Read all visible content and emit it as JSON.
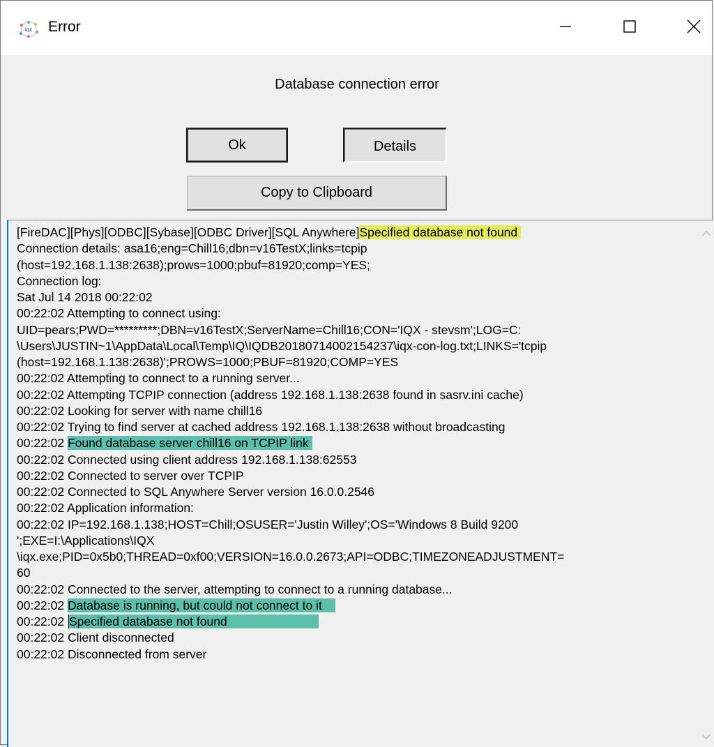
{
  "window": {
    "title": "Error",
    "icon": "iqx-app-icon",
    "controls": [
      "minimize-icon",
      "maximize-icon",
      "close-icon"
    ]
  },
  "message": "Database connection error",
  "buttons": {
    "ok": "Ok",
    "details": "Details",
    "copy": "Copy to Clipboard"
  },
  "log": {
    "lines": [
      {
        "pre": "[FireDAC][Phys][ODBC][Sybase][ODBC Driver][SQL Anywhere]",
        "hl": "Specified database not found ",
        "hl_color": "yellow",
        "post": ""
      },
      {
        "pre": "Connection details: asa16;eng=Chill16;dbn=v16TestX;links=tcpip",
        "hl": "",
        "post": ""
      },
      {
        "pre": "(host=192.168.1.138:2638);prows=1000;pbuf=81920;comp=YES;",
        "hl": "",
        "post": ""
      },
      {
        "pre": "Connection log:",
        "hl": "",
        "post": ""
      },
      {
        "pre": "Sat Jul 14 2018 00:22:02",
        "hl": "",
        "post": ""
      },
      {
        "pre": "00:22:02 Attempting to connect using:",
        "hl": "",
        "post": ""
      },
      {
        "pre": "UID=pears;PWD=*********;DBN=v16TestX;ServerName=Chill16;CON='IQX - stevsm';LOG=C:",
        "hl": "",
        "post": ""
      },
      {
        "pre": "\\Users\\JUSTIN~1\\AppData\\Local\\Temp\\IQ\\IQDB20180714002154237\\iqx-con-log.txt;LINKS='tcpip",
        "hl": "",
        "post": ""
      },
      {
        "pre": "(host=192.168.1.138:2638)';PROWS=1000;PBUF=81920;COMP=YES",
        "hl": "",
        "post": ""
      },
      {
        "pre": "00:22:02 Attempting to connect to a running server...",
        "hl": "",
        "post": ""
      },
      {
        "pre": "00:22:02 Attempting TCPIP connection (address 192.168.1.138:2638 found in sasrv.ini cache)",
        "hl": "",
        "post": ""
      },
      {
        "pre": "00:22:02 Looking for server with name chill16",
        "hl": "",
        "post": ""
      },
      {
        "pre": "00:22:02 Trying to find server at cached address 192.168.1.138:2638 without broadcasting",
        "hl": "",
        "post": ""
      },
      {
        "pre": "00:22:02 ",
        "hl": "Found database server chill16 on TCPIP link ",
        "hl_color": "teal",
        "post": ""
      },
      {
        "pre": "00:22:02 Connected using client address 192.168.1.138:62553",
        "hl": "",
        "post": ""
      },
      {
        "pre": "00:22:02 Connected to server over TCPIP",
        "hl": "",
        "post": ""
      },
      {
        "pre": "00:22:02 Connected to SQL Anywhere Server version 16.0.0.2546",
        "hl": "",
        "post": ""
      },
      {
        "pre": "00:22:02 Application information:",
        "hl": "",
        "post": ""
      },
      {
        "pre": "00:22:02 IP=192.168.1.138;HOST=Chill;OSUSER='Justin Willey';OS='Windows 8 Build 9200",
        "hl": "",
        "post": ""
      },
      {
        "pre": "';EXE=I:\\Applications\\IQX",
        "hl": "",
        "post": ""
      },
      {
        "pre": "\\iqx.exe;PID=0x5b0;THREAD=0xf00;VERSION=16.0.0.2673;API=ODBC;TIMEZONEADJUSTMENT=",
        "hl": "",
        "post": ""
      },
      {
        "pre": "60",
        "hl": "",
        "post": ""
      },
      {
        "pre": "00:22:02 Connected to the server, attempting to connect to a running database...",
        "hl": "",
        "post": ""
      },
      {
        "pre": "00:22:02 ",
        "hl": "Database is running, but could not connect to it    ",
        "hl_color": "teal",
        "post": ""
      },
      {
        "pre": "00:22:02 ",
        "hl": "Specified database not found                           ",
        "hl_color": "teal",
        "post": ""
      },
      {
        "pre": "00:22:02 Client disconnected",
        "hl": "",
        "post": ""
      },
      {
        "pre": "00:22:02 Disconnected from server",
        "hl": "",
        "post": ""
      }
    ]
  },
  "colors": {
    "highlight_yellow": "#e6ec5a",
    "highlight_teal": "#5cbfac",
    "focus_border": "#0078d7"
  }
}
